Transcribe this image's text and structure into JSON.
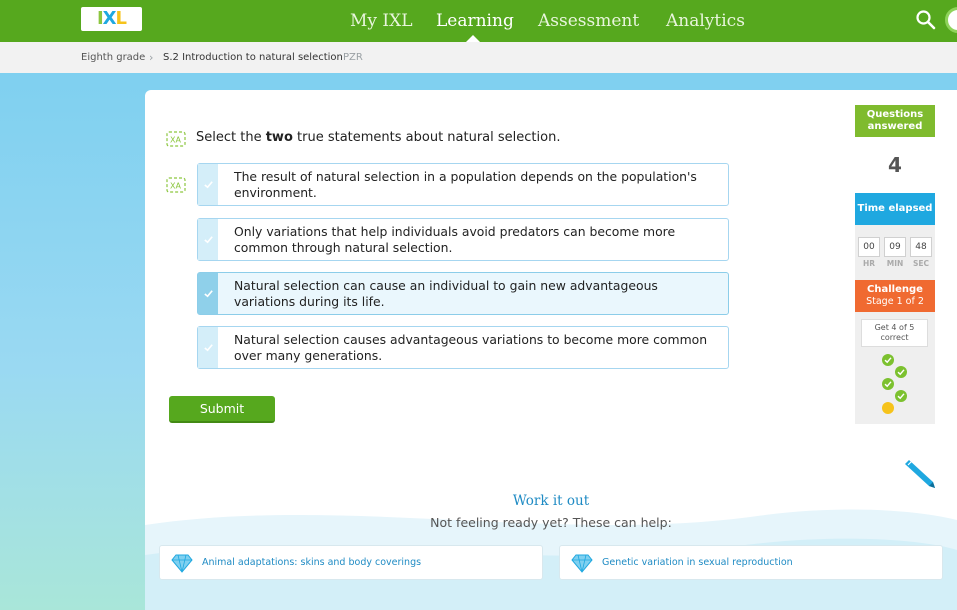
{
  "app": {
    "logo_text": "IXL"
  },
  "nav": {
    "items": [
      {
        "label": "My IXL"
      },
      {
        "label": "Learning",
        "active": true
      },
      {
        "label": "Assessment"
      },
      {
        "label": "Analytics"
      }
    ],
    "search_icon": "search-icon"
  },
  "breadcrumb": {
    "grade": "Eighth grade",
    "skill": "S.2 Introduction to natural selection",
    "code": "PZR"
  },
  "question": {
    "prefix": "Select the ",
    "emphasis": "two",
    "suffix": " true statements about natural selection.",
    "choices": [
      {
        "text": "The result of natural selection in a population depends on the population's environment.",
        "selected": false
      },
      {
        "text": "Only variations that help individuals avoid predators can become more common through natural selection.",
        "selected": false
      },
      {
        "text": "Natural selection can cause an individual to gain new advantageous variations during its life.",
        "selected": true
      },
      {
        "text": "Natural selection causes advantageous variations to become more common over many generations.",
        "selected": false
      }
    ],
    "submit_label": "Submit"
  },
  "sidebar": {
    "questions_answered_label": "Questions answered",
    "questions_answered": "4",
    "time_elapsed_label": "Time elapsed",
    "time": {
      "hr": "00",
      "min": "09",
      "sec": "48"
    },
    "time_units": {
      "hr": "HR",
      "min": "MIN",
      "sec": "SEC"
    },
    "challenge_label": "Challenge",
    "challenge_stage": "Stage 1 of 2",
    "challenge_goal": "Get 4 of 5 correct",
    "progress": {
      "correct": 4,
      "total": 5
    }
  },
  "work_it_out": {
    "title": "Work it out",
    "subtitle": "Not feeling ready yet? These can help:",
    "links": [
      {
        "label": "Animal adaptations: skins and body coverings"
      },
      {
        "label": "Genetic variation in sexual reproduction"
      }
    ]
  },
  "colors": {
    "brand_green": "#56a81e",
    "accent_blue": "#1fa8e0",
    "challenge_orange": "#f06a31"
  }
}
